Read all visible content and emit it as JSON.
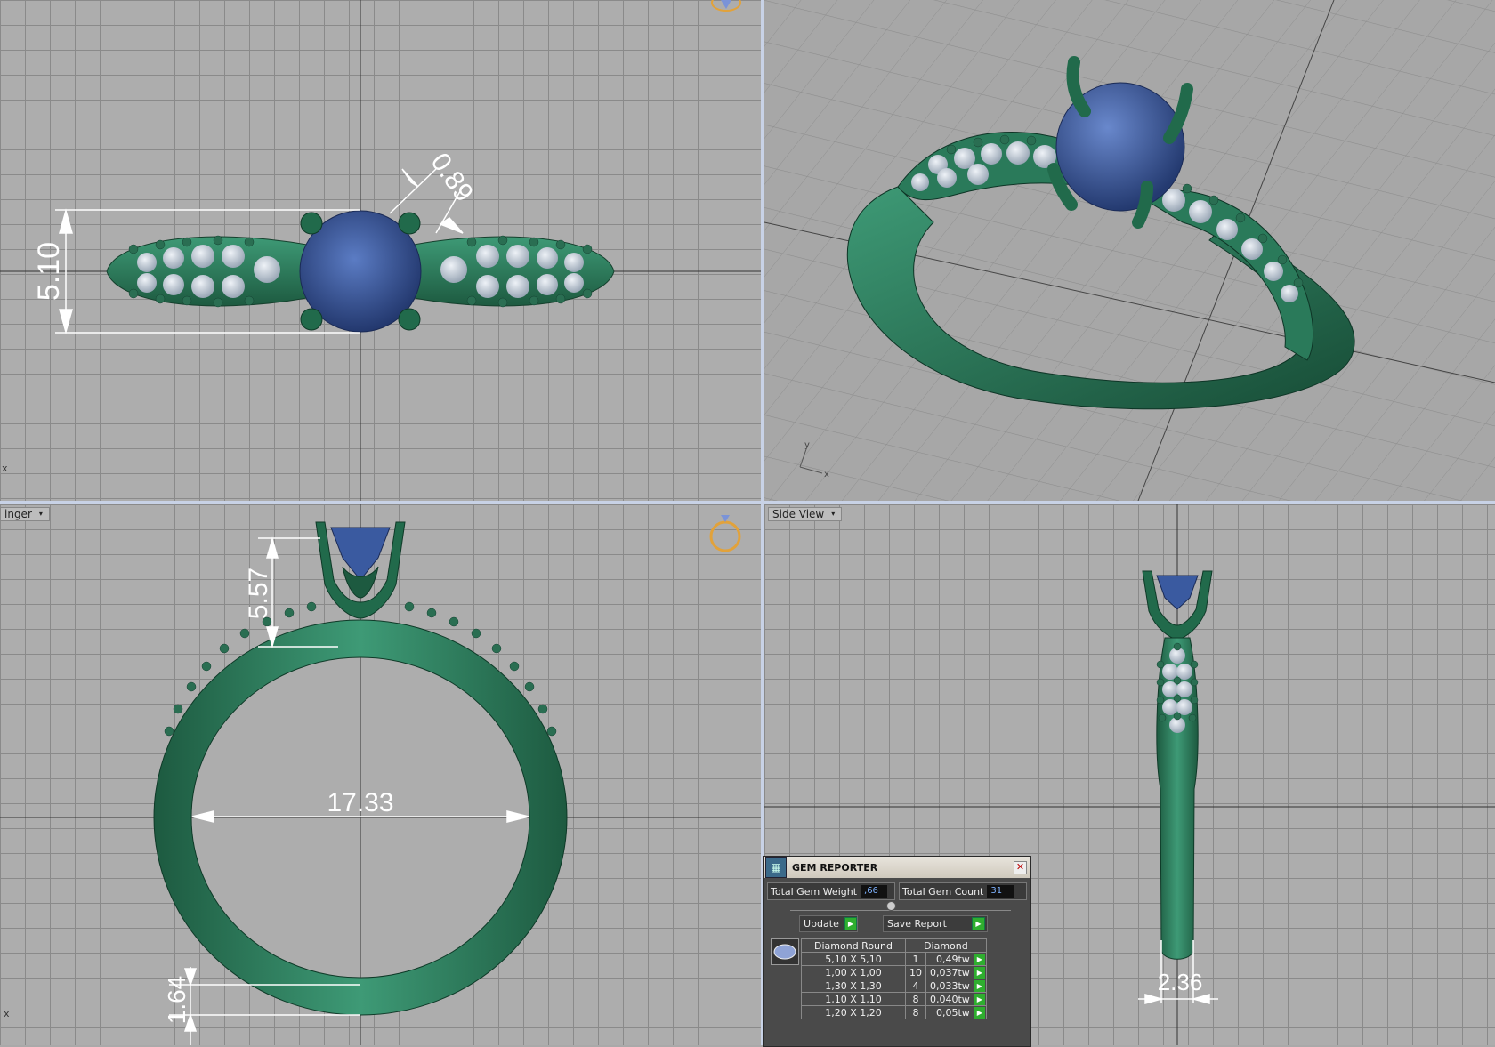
{
  "viewports": {
    "top": {
      "axis_label": "x",
      "dim_width": "5.10",
      "dim_prong": "0.89"
    },
    "perspective": {
      "axis_x": "x",
      "axis_y": "y"
    },
    "front": {
      "menu_label": "inger",
      "axis_label": "x",
      "dim_head": "5.57",
      "dim_inner": "17.33",
      "dim_shank": "1.64"
    },
    "side": {
      "menu_label": "Side View",
      "dim_width": "2.36"
    }
  },
  "gem_reporter": {
    "title": "GEM REPORTER",
    "close_label": "✕",
    "total_weight_label": "Total Gem Weight",
    "total_weight_value": ",66",
    "total_count_label": "Total Gem Count",
    "total_count_value": "31",
    "update_label": "Update",
    "save_label": "Save Report",
    "table": {
      "headers": [
        "Diamond Round",
        "Diamond"
      ],
      "rows": [
        {
          "size": "5,10 X 5,10",
          "qty": "1",
          "weight": "0,49tw"
        },
        {
          "size": "1,00 X 1,00",
          "qty": "10",
          "weight": "0,037tw"
        },
        {
          "size": "1,30 X 1,30",
          "qty": "4",
          "weight": "0,033tw"
        },
        {
          "size": "1,10 X 1,10",
          "qty": "8",
          "weight": "0,040tw"
        },
        {
          "size": "1,20 X 1,20",
          "qty": "8",
          "weight": "0,05tw"
        }
      ]
    }
  },
  "colors": {
    "metal": "#2e7d5e",
    "gem": "#3a5aa0",
    "grid_bg": "#adadad",
    "dim_text": "#ffffff"
  }
}
